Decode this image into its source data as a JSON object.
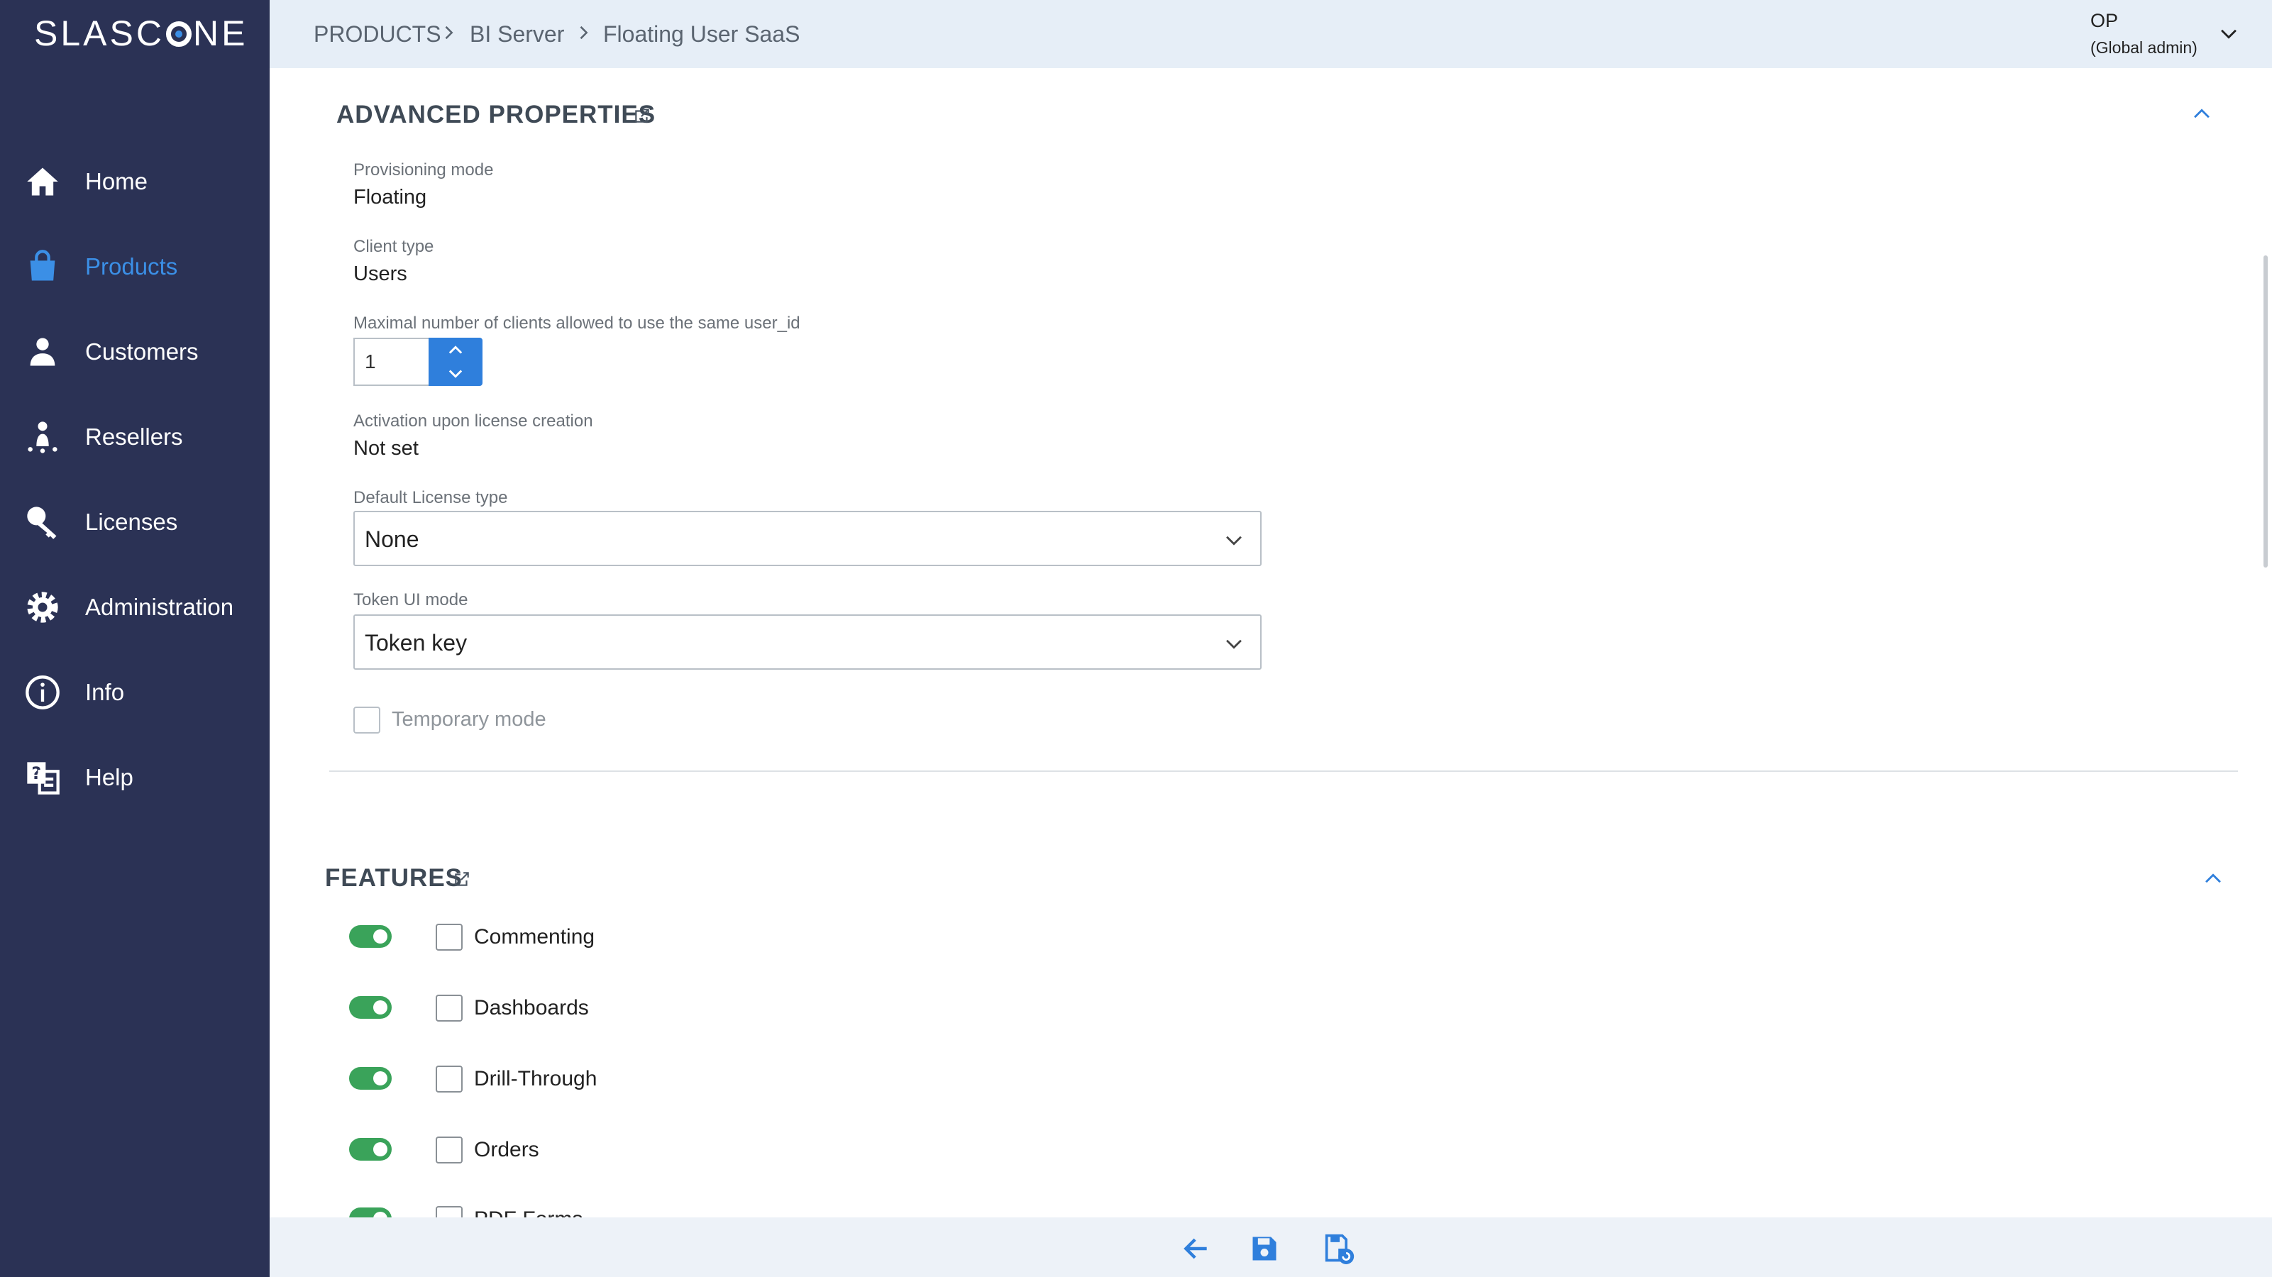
{
  "brand": {
    "logo_text_left": "SLASC",
    "logo_text_right": "NE",
    "accent_color": "#3b8fe6",
    "sidebar_bg": "#2b3255"
  },
  "sidebar": {
    "items": [
      {
        "label": "Home",
        "icon": "home-icon",
        "active": false
      },
      {
        "label": "Products",
        "icon": "shopping-bag-icon",
        "active": true
      },
      {
        "label": "Customers",
        "icon": "person-icon",
        "active": false
      },
      {
        "label": "Resellers",
        "icon": "reseller-icon",
        "active": false
      },
      {
        "label": "Licenses",
        "icon": "key-icon",
        "active": false
      },
      {
        "label": "Administration",
        "icon": "gear-icon",
        "active": false
      },
      {
        "label": "Info",
        "icon": "info-icon",
        "active": false
      },
      {
        "label": "Help",
        "icon": "help-icon",
        "active": false
      }
    ]
  },
  "breadcrumb": [
    "PRODUCTS",
    "BI Server",
    "Floating User SaaS"
  ],
  "user": {
    "name": "OP",
    "role": "(Global admin)"
  },
  "advanced": {
    "title": "ADVANCED PROPERTIES",
    "provisioning_label": "Provisioning mode",
    "provisioning_value": "Floating",
    "client_type_label": "Client type",
    "client_type_value": "Users",
    "max_clients_label": "Maximal number of clients allowed to use the same user_id",
    "max_clients_value": "1",
    "activation_label": "Activation upon license creation",
    "activation_value": "Not set",
    "license_type_label": "Default License type",
    "license_type_value": "None",
    "token_ui_label": "Token UI mode",
    "token_ui_value": "Token key",
    "temporary_label": "Temporary mode"
  },
  "features": {
    "title": "FEATURES",
    "toggle_color": "#3aa35a",
    "items": [
      {
        "label": "Commenting",
        "enabled": true,
        "checked": false
      },
      {
        "label": "Dashboards",
        "enabled": true,
        "checked": false
      },
      {
        "label": "Drill-Through",
        "enabled": true,
        "checked": false
      },
      {
        "label": "Orders",
        "enabled": true,
        "checked": false
      },
      {
        "label": "PDF Forms",
        "enabled": true,
        "checked": false
      }
    ]
  },
  "toolbar": {
    "icons": [
      "back-arrow-icon",
      "save-icon",
      "save-and-reload-icon"
    ]
  }
}
